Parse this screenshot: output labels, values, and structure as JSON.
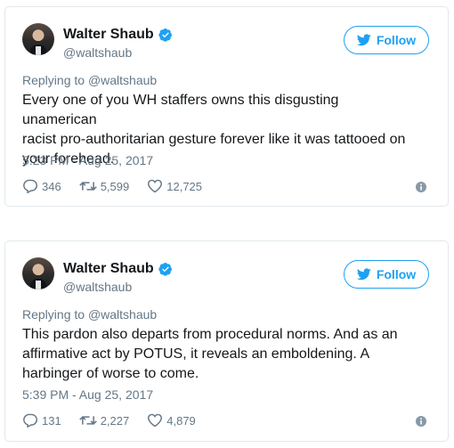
{
  "tweets": [
    {
      "display_name": "Walter Shaub",
      "handle": "@waltshaub",
      "follow_label": "Follow",
      "replying_prefix": "Replying to",
      "replying_to": "@waltshaub",
      "lines": [
        "Every one of you WH staffers owns this disgusting unamerican",
        "racist pro-authoritarian gesture forever like it was tattooed on",
        "your forehead."
      ],
      "timestamp": "5:23 PM - Aug 25, 2017",
      "replies": "346",
      "retweets": "5,599",
      "likes": "12,725"
    },
    {
      "display_name": "Walter Shaub",
      "handle": "@waltshaub",
      "follow_label": "Follow",
      "replying_prefix": "Replying to",
      "replying_to": "@waltshaub",
      "lines": [
        "This pardon also departs from procedural norms. And as an",
        "affirmative act by POTUS, it reveals an emboldening. A",
        "harbinger of worse to come."
      ],
      "timestamp": "5:39 PM - Aug 25, 2017",
      "replies": "131",
      "retweets": "2,227",
      "likes": "4,879"
    }
  ],
  "colors": {
    "twitter_blue": "#1da1f2",
    "secondary_text": "#657786",
    "primary_text": "#14171a",
    "border": "#e1e8ed"
  },
  "icons": {
    "verified": "verified-badge-icon",
    "follow": "twitter-bird-icon",
    "reply": "reply-icon",
    "retweet": "retweet-icon",
    "like": "heart-icon",
    "info": "info-icon"
  }
}
